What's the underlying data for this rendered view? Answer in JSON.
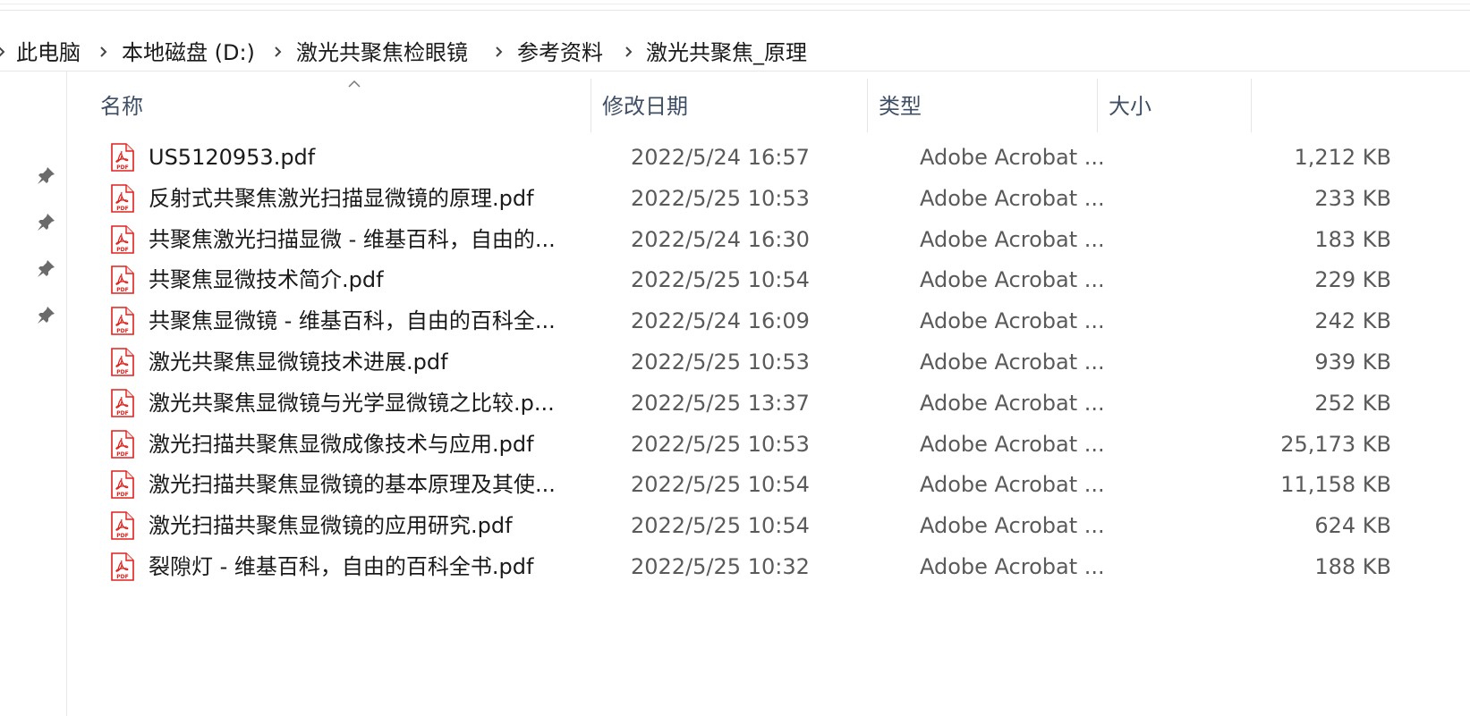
{
  "breadcrumb": {
    "items": [
      "此电脑",
      "本地磁盘 (D:)",
      "激光共聚焦检眼镜",
      "参考资料",
      "激光共聚焦_原理"
    ]
  },
  "columns": {
    "name": "名称",
    "modified": "修改日期",
    "type": "类型",
    "size": "大小"
  },
  "files": [
    {
      "name": "US5120953.pdf",
      "modified": "2022/5/24 16:57",
      "type": "Adobe Acrobat ...",
      "size": "1,212 KB"
    },
    {
      "name": "反射式共聚焦激光扫描显微镜的原理.pdf",
      "modified": "2022/5/25 10:53",
      "type": "Adobe Acrobat ...",
      "size": "233 KB"
    },
    {
      "name": "共聚焦激光扫描显微 - 维基百科，自由的...",
      "modified": "2022/5/24 16:30",
      "type": "Adobe Acrobat ...",
      "size": "183 KB"
    },
    {
      "name": "共聚焦显微技术简介.pdf",
      "modified": "2022/5/25 10:54",
      "type": "Adobe Acrobat ...",
      "size": "229 KB"
    },
    {
      "name": "共聚焦显微镜 - 维基百科，自由的百科全...",
      "modified": "2022/5/24 16:09",
      "type": "Adobe Acrobat ...",
      "size": "242 KB"
    },
    {
      "name": "激光共聚焦显微镜技术进展.pdf",
      "modified": "2022/5/25 10:53",
      "type": "Adobe Acrobat ...",
      "size": "939 KB"
    },
    {
      "name": "激光共聚焦显微镜与光学显微镜之比较.p...",
      "modified": "2022/5/25 13:37",
      "type": "Adobe Acrobat ...",
      "size": "252 KB"
    },
    {
      "name": "激光扫描共聚焦显微成像技术与应用.pdf",
      "modified": "2022/5/25 10:53",
      "type": "Adobe Acrobat ...",
      "size": "25,173 KB"
    },
    {
      "name": "激光扫描共聚焦显微镜的基本原理及其使...",
      "modified": "2022/5/25 10:54",
      "type": "Adobe Acrobat ...",
      "size": "11,158 KB"
    },
    {
      "name": "激光扫描共聚焦显微镜的应用研究.pdf",
      "modified": "2022/5/25 10:54",
      "type": "Adobe Acrobat ...",
      "size": "624 KB"
    },
    {
      "name": "裂隙灯 - 维基百科，自由的百科全书.pdf",
      "modified": "2022/5/25 10:32",
      "type": "Adobe Acrobat ...",
      "size": "188 KB"
    }
  ],
  "file_icon": {
    "name": "pdf-file-icon",
    "label": "PDF",
    "color": "#e0201b"
  },
  "quick_access_pins": 4,
  "colors": {
    "text": "#1a1a1a",
    "secondary_text": "#5a5a5a",
    "header_text": "#3f4f66",
    "pdf_red": "#e0201b"
  }
}
